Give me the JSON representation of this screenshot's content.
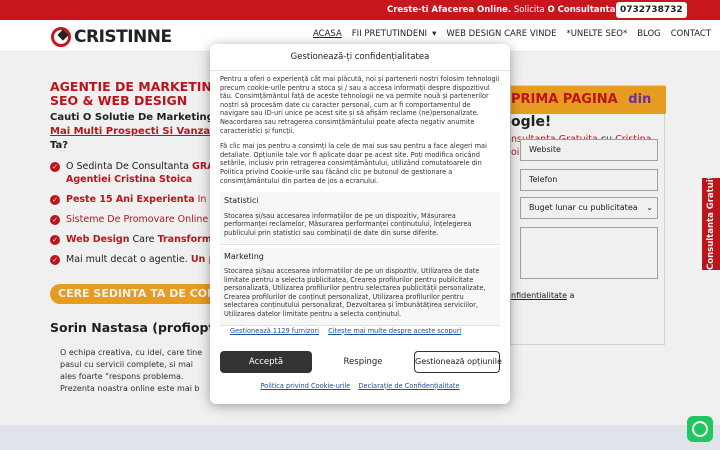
{
  "topbar": {
    "promo_prefix": "Creste-ti Afacerea Online.",
    "promo_mid": "Solicita",
    "promo_strong": "O Consultanta Gratuita!",
    "phone": "0732738732"
  },
  "header": {
    "logo": "CRISTINNE",
    "nav": [
      {
        "label": "ACASA",
        "active": true
      },
      {
        "label": "FII PRETUTINDENI",
        "dropdown": true
      },
      {
        "label": "WEB DESIGN CARE VINDE"
      },
      {
        "label": "*UNELTE SEO*"
      },
      {
        "label": "BLOG"
      },
      {
        "label": "CONTACT"
      }
    ]
  },
  "hero": {
    "title_line1": "AGENTIE DE MARKETING",
    "title_line2": "SEO & WEB DESIGN",
    "sub_line1": "Cauti O Solutie De Marketing",
    "sub_line2": "Mai Multi Prospecti Si Vanzari",
    "sub_line3": "Ta?",
    "checks": [
      {
        "a": "O Sedinta De Consultanta",
        "b": "GRATU"
      },
      {
        "a": "Agentiei Cristina Stoica",
        "b": ""
      },
      {
        "a": "Peste 15 Ani Experienta",
        "b": "In PPC,"
      },
      {
        "a": "Sisteme De Promovare Online Cu",
        "b": "I"
      },
      {
        "a": "Web Design",
        "b": "Care",
        "c": "Transforma V"
      },
      {
        "a": "Mai mult decat o agentie.",
        "b": "Un part"
      }
    ],
    "cta": "CERE SEDINTA TA DE CON",
    "testimonial_name": "Sorin Nastasa (profiopti",
    "testimonial_text": "O echipa creativa, cu idei, care tine pasul cu servicii complete, si mai ales foarte \"respons problema. Prezenta noastra online este mai b"
  },
  "form": {
    "head_a": "PRIMA PAGINA",
    "head_b": "din",
    "head_c": "ogle!",
    "offer_a": "nsultanta Gratuita",
    "offer_b": "cu",
    "offer_c": "Cristina",
    "offer_d": "oica",
    "fields": [
      "Website",
      "Telefon"
    ],
    "budget": "Buget lunar cu publicitatea",
    "consent_a": "nfidentialitate",
    "consent_b": "a"
  },
  "side_tab": "Consultanta Gratuita",
  "modal": {
    "title": "Gestionează-ți confidențialitatea",
    "intro_p1": "Pentru a oferi o experiență cât mai plăcută, noi și partenerii noștri folosim tehnologii precum cookie-urile pentru a stoca și / sau a accesa informații despre dispozitivul tău. Consimțământul față de aceste tehnologii ne va permite nouă și partenerilor noștri să procesăm date cu caracter personal, cum ar fi comportamentul de navigare sau ID-uri unice pe acest site și să afișăm reclame (ne)personalizate. Neacordarea sau retragerea consimțământului poate afecta negativ anumite caracteristici și funcții.",
    "intro_p2": "Fă clic mai jos pentru a consimți la cele de mai sus sau pentru a face alegeri mai detaliate. Opțiunile tale vor fi aplicate doar pe acest site. Poți modifica oricând setările, inclusiv prin retragerea consimțământului, utilizând comutatoarele din Politica privind Cookie-urile sau făcând clic pe butonul de gestionare a consimțământului din partea de jos a ecranului.",
    "sections": [
      {
        "title": "Statistici",
        "body": "Stocarea și/sau accesarea informațiilor de pe un dispozitiv, Măsurarea performanței reclamelor, Măsurarea performanței conținutului, Înțelegerea publicului prin statistici sau combinații de date din surse diferite."
      },
      {
        "title": "Marketing",
        "body": "Stocarea și/sau accesarea informațiilor de pe un dispozitiv, Utilizarea de date limitate pentru a selecta publicitatea, Crearea profilurilor pentru publicitate personalizată, Utilizarea profilurilor pentru selectarea publicității personalizate, Crearea profilurilor de conținut personalizat, Utilizarea profilurilor pentru selectarea conținutului personalizat, Dezvoltarea și îmbunătățirea serviciilor, Utilizarea datelor limitate pentru a selecta conținutul."
      }
    ],
    "link_vendors": "Gestionează 1129 furnizori",
    "link_more": "Citește mai multe despre aceste scopuri",
    "accept": "Acceptă",
    "refuse": "Respinge",
    "manage": "Gestionează opțiunile",
    "footer_cookie": "Politica privind Cookie-urile",
    "footer_privacy": "Declarație de Confidențialitate"
  },
  "colors": {
    "brand_red": "#c8161d",
    "accent_orange": "#f5a623",
    "whatsapp": "#25d366"
  },
  "icons": [
    "logo-mark-icon",
    "check-icon",
    "chevron-down-icon",
    "whatsapp-icon"
  ]
}
